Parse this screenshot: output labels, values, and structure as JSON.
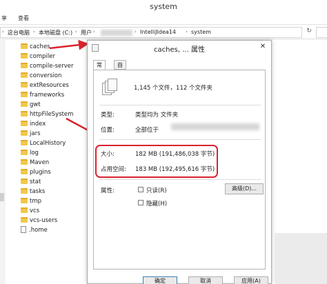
{
  "explorer": {
    "title": "system",
    "ribbon": {
      "share_tab": "享",
      "view_tab": "查看"
    },
    "address": {
      "crumbs": [
        "这台电脑",
        "本地磁盘 (C:)",
        "用户",
        "IntelliJIdea14",
        "system"
      ],
      "separator": "›",
      "refresh_glyph": "↻"
    },
    "files": [
      {
        "name": "caches",
        "type": "folder"
      },
      {
        "name": "compiler",
        "type": "folder"
      },
      {
        "name": "compile-server",
        "type": "folder"
      },
      {
        "name": "conversion",
        "type": "folder"
      },
      {
        "name": "extResources",
        "type": "folder"
      },
      {
        "name": "frameworks",
        "type": "folder"
      },
      {
        "name": "gwt",
        "type": "folder"
      },
      {
        "name": "httpFileSystem",
        "type": "folder"
      },
      {
        "name": "index",
        "type": "folder"
      },
      {
        "name": "jars",
        "type": "folder"
      },
      {
        "name": "LocalHistory",
        "type": "folder"
      },
      {
        "name": "log",
        "type": "folder"
      },
      {
        "name": "Maven",
        "type": "folder"
      },
      {
        "name": "plugins",
        "type": "folder"
      },
      {
        "name": "stat",
        "type": "folder"
      },
      {
        "name": "tasks",
        "type": "folder"
      },
      {
        "name": "tmp",
        "type": "folder"
      },
      {
        "name": "vcs",
        "type": "folder"
      },
      {
        "name": "vcs-users",
        "type": "folder"
      },
      {
        "name": ".home",
        "type": "file"
      }
    ]
  },
  "dialog": {
    "title": "caches, ... 属性",
    "close_glyph": "✕",
    "tabs": [
      "常规",
      "自定义"
    ],
    "summary": "1,145 个文件，112 个文件夹",
    "type_label": "类型:",
    "type_value": "类型均为 文件夹",
    "location_label": "位置:",
    "location_value": "全部位于",
    "size_label": "大小:",
    "size_value": "182 MB (191,486,038 字节)",
    "disk_label": "占用空间:",
    "disk_value": "183 MB (192,495,616 字节)",
    "attributes_label": "属性:",
    "readonly_label": "只读(R)",
    "hidden_label": "隐藏(H)",
    "advanced_button": "高级(D)...",
    "ok_button": "确定",
    "cancel_button": "取消",
    "apply_button": "应用(A)"
  },
  "colors": {
    "annotation_red": "#d9232e",
    "folder_yellow": "#f1c84b"
  }
}
